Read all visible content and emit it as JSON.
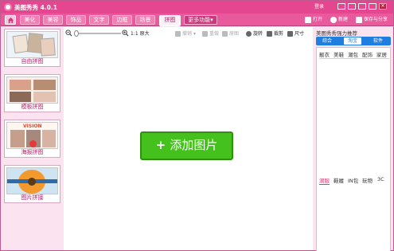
{
  "window": {
    "title": "美图秀秀 4.0.1",
    "sys_label": "登录"
  },
  "tabs": [
    {
      "label": "美化"
    },
    {
      "label": "美容"
    },
    {
      "label": "饰品"
    },
    {
      "label": "文字"
    },
    {
      "label": "边框"
    },
    {
      "label": "场景"
    },
    {
      "label": "拼图",
      "active": true
    },
    {
      "label": "更多功能"
    }
  ],
  "header_actions": {
    "open": "打开",
    "new": "新建",
    "save": "保存与分享"
  },
  "toolbar": {
    "zoom_label": "1:1 原大",
    "undo": "撤销",
    "redo": "重做",
    "reset": "原图",
    "rotate": "旋转",
    "crop": "裁剪",
    "size": "尺寸"
  },
  "left_cards": [
    {
      "label": "自由拼图",
      "icon": "free-collage"
    },
    {
      "label": "模板拼图",
      "icon": "template-collage"
    },
    {
      "label": "海报拼图",
      "icon": "poster-collage",
      "thumb_text": "VISION"
    },
    {
      "label": "图片拼接",
      "icon": "image-stitch"
    }
  ],
  "main": {
    "add_button": "添加图片"
  },
  "right_panel": {
    "title": "美图秀秀强力推荐",
    "tabs": [
      "综合",
      "淘宝",
      "软件"
    ],
    "active_tab": "淘宝",
    "categories": [
      "靓衣",
      "美鞋",
      "潮包",
      "配饰",
      "家居"
    ],
    "bottom_categories": [
      "潮服",
      "鞋履",
      "IN包",
      "玩物",
      "3C"
    ],
    "active_bottom": "潮服"
  },
  "colors": {
    "brand": "#e4468f",
    "accent_green": "#45c11d",
    "tab_blue": "#1e7fe0"
  }
}
